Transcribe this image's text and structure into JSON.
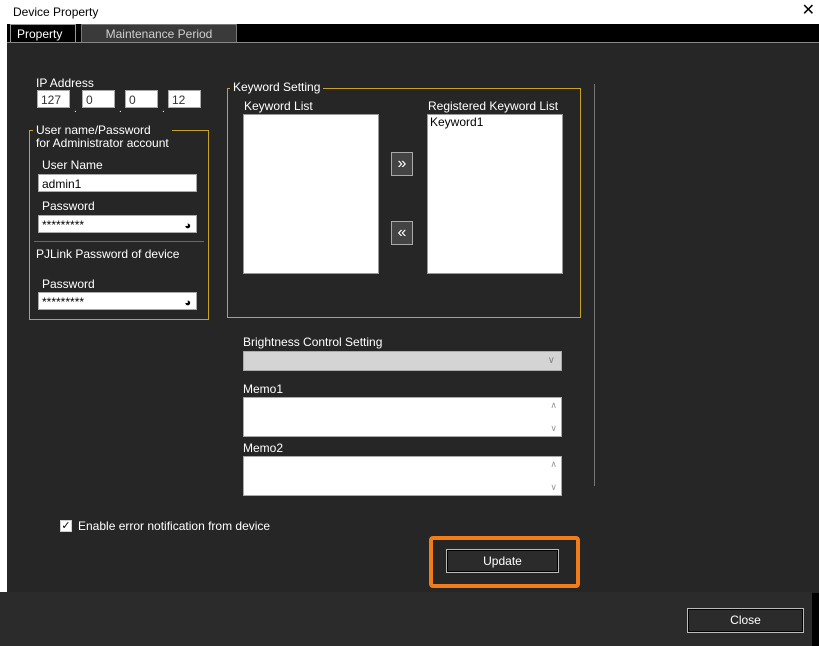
{
  "window": {
    "title": "Device Property",
    "close_glyph": "✕"
  },
  "tabs": [
    {
      "label": "Property",
      "active": true
    },
    {
      "label": "Maintenance Period",
      "active": false
    }
  ],
  "ip": {
    "label": "IP Address",
    "octets": [
      "127",
      "0",
      "0",
      "12"
    ]
  },
  "admin": {
    "group_title_line1": "User name/Password",
    "group_title_line2": "for Administrator account",
    "username_label": "User Name",
    "username_value": "admin1",
    "password_label": "Password",
    "password_value": "*********",
    "pjlink_label": "PJLink Password of device",
    "pjlink_password_label": "Password",
    "pjlink_password_value": "*********"
  },
  "keyword": {
    "group_title": "Keyword Setting",
    "list_label": "Keyword List",
    "list_items": [],
    "registered_label": "Registered Keyword List",
    "registered_items": [
      "Keyword1"
    ],
    "add_glyph": "»",
    "remove_glyph": "«"
  },
  "brightness": {
    "label": "Brightness Control Setting",
    "value": ""
  },
  "memo1": {
    "label": "Memo1",
    "value": ""
  },
  "memo2": {
    "label": "Memo2",
    "value": ""
  },
  "error_notification": {
    "label": "Enable error notification from device",
    "checked": true
  },
  "buttons": {
    "update": "Update",
    "close": "Close"
  },
  "colors": {
    "accent_border": "#c8a12a",
    "highlight": "#f07c1a",
    "panel_bg": "#262626"
  }
}
